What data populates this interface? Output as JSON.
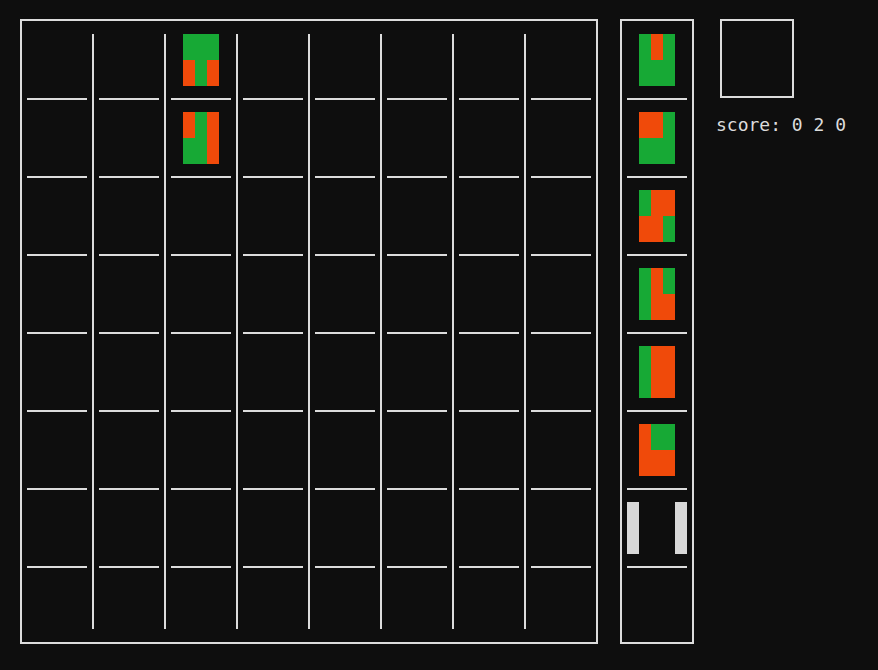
{
  "board": [
    [
      null,
      null,
      null,
      null,
      null,
      null,
      null,
      null
    ],
    [
      null,
      null,
      null,
      null,
      null,
      null,
      null,
      null
    ],
    [
      {
        "kind": "tile",
        "colors": [
          [
            "#17a935",
            "#17a935",
            "#17a935"
          ],
          [
            "#f04a0a",
            "#17a935",
            "#f04a0a"
          ]
        ]
      },
      {
        "kind": "tile",
        "colors": [
          [
            "#f04a0a",
            "#17a935",
            "#f04a0a"
          ],
          [
            "#17a935",
            "#17a935",
            "#f04a0a"
          ]
        ]
      },
      null,
      null,
      null,
      null,
      null,
      null
    ],
    [
      null,
      null,
      null,
      null,
      null,
      null,
      null,
      null
    ],
    [
      null,
      null,
      null,
      null,
      null,
      null,
      null,
      null
    ],
    [
      null,
      null,
      null,
      null,
      null,
      null,
      null,
      null
    ],
    [
      null,
      null,
      null,
      null,
      null,
      null,
      null,
      null
    ],
    [
      null,
      null,
      null,
      null,
      null,
      null,
      null,
      null
    ]
  ],
  "queue": [
    {
      "kind": "tile",
      "colors": [
        [
          "#17a935",
          "#f04a0a",
          "#17a935"
        ],
        [
          "#17a935",
          "#17a935",
          "#17a935"
        ]
      ]
    },
    {
      "kind": "tile",
      "colors": [
        [
          "#f04a0a",
          "#f04a0a",
          "#17a935"
        ],
        [
          "#17a935",
          "#17a935",
          "#17a935"
        ]
      ]
    },
    {
      "kind": "tile",
      "colors": [
        [
          "#17a935",
          "#f04a0a",
          "#f04a0a"
        ],
        [
          "#f04a0a",
          "#f04a0a",
          "#17a935"
        ]
      ]
    },
    {
      "kind": "tile",
      "colors": [
        [
          "#17a935",
          "#f04a0a",
          "#17a935"
        ],
        [
          "#17a935",
          "#f04a0a",
          "#f04a0a"
        ]
      ]
    },
    {
      "kind": "tile",
      "colors": [
        [
          "#17a935",
          "#f04a0a",
          "#f04a0a"
        ],
        [
          "#17a935",
          "#f04a0a",
          "#f04a0a"
        ]
      ]
    },
    {
      "kind": "tile",
      "colors": [
        [
          "#f04a0a",
          "#17a935",
          "#17a935"
        ],
        [
          "#f04a0a",
          "#f04a0a",
          "#f04a0a"
        ]
      ]
    },
    {
      "kind": "cursor"
    }
  ],
  "hold": null,
  "score": "score: 0 2 0"
}
